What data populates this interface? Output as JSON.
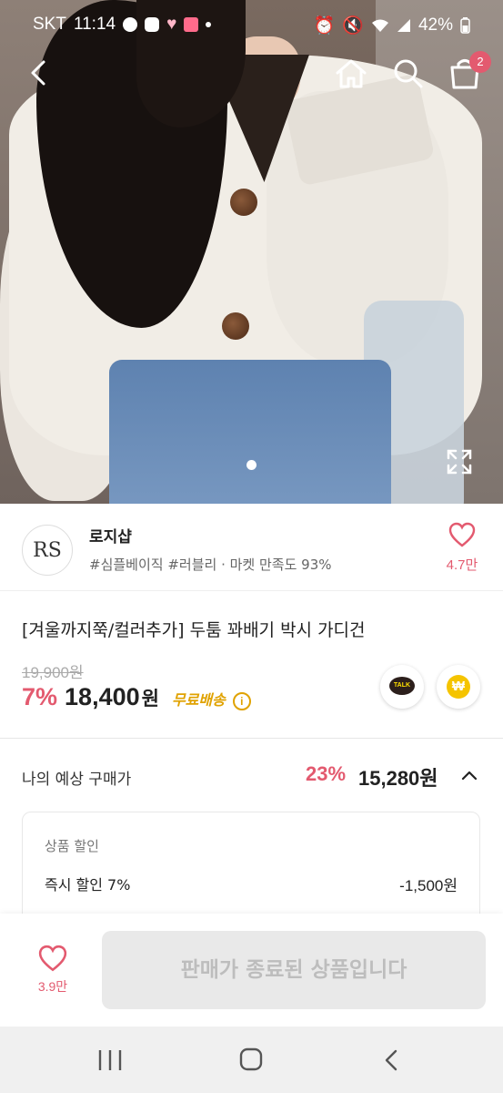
{
  "status": {
    "carrier": "SKT",
    "time": "11:14",
    "battery": "42%"
  },
  "header": {
    "cart_count": "2"
  },
  "store": {
    "logo_text": "RS",
    "name": "로지샵",
    "tags": "#심플베이직 #러블리 · 마켓 만족도 93%",
    "wish_count": "4.7만"
  },
  "product": {
    "title": "[겨울까지쭉/컬러추가] 두툼 꽈배기 박시 가디건",
    "original_price": "19,900원",
    "discount_rate": "7%",
    "price": "18,400",
    "price_unit": "원",
    "free_shipping": "무료배송",
    "talk_label": "TALK",
    "pay_label": "₩"
  },
  "expected": {
    "label": "나의 예상 구매가",
    "rate": "23%",
    "amount": "15,280원"
  },
  "discount_box": {
    "header": "상품 할인",
    "row_label": "즉시 할인 7%",
    "row_value": "-1,500원"
  },
  "bottom": {
    "wish_count": "3.9만",
    "ended_label": "판매가 종료된 상품입니다"
  },
  "colors": {
    "accent": "#e35a6f",
    "shipping": "#e0a200"
  }
}
